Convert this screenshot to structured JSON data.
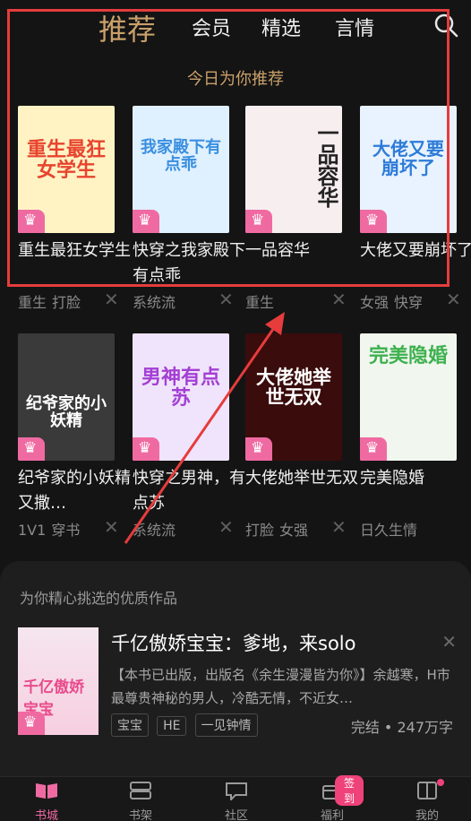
{
  "header": {
    "tabs": [
      "推荐",
      "会员",
      "精选",
      "言情"
    ]
  },
  "section_title": "今日为你推荐",
  "books": [
    {
      "title": "重生最狂女学生",
      "tags": [
        "重生",
        "打脸"
      ],
      "cover_text": "重生最狂女学生",
      "cover_bg": "#fff3c4",
      "cover_fg": "#e8442e"
    },
    {
      "title": "快穿之我家殿下有点乖",
      "tags": [
        "系统流"
      ],
      "cover_text": "我家殿下有点乖",
      "cover_bg": "#dff0ff",
      "cover_fg": "#3a8fe0"
    },
    {
      "title": "一品容华",
      "tags": [
        "重生"
      ],
      "cover_text": "一品容华",
      "cover_bg": "#f7eef0",
      "cover_fg": "#222222"
    },
    {
      "title": "大佬又要崩坏了",
      "tags": [
        "女强",
        "快穿"
      ],
      "cover_text": "大佬又要崩坏了",
      "cover_bg": "#e8f3ff",
      "cover_fg": "#2d7bd8"
    },
    {
      "title": "纪爷家的小妖精又撒…",
      "tags": [
        "1V1",
        "穿书"
      ],
      "cover_text": "纪爷家的小妖精",
      "cover_bg": "#3a3a3a",
      "cover_fg": "#ffffff"
    },
    {
      "title": "快穿之男神，有点苏",
      "tags": [
        "系统流"
      ],
      "cover_text": "男神有点苏",
      "cover_bg": "#efe4fb",
      "cover_fg": "#a43fd4"
    },
    {
      "title": "大佬她举世无双",
      "tags": [
        "打脸",
        "女强"
      ],
      "cover_text": "大佬她举世无双",
      "cover_bg": "#3a0c0c",
      "cover_fg": "#ffffff"
    },
    {
      "title": "完美隐婚",
      "tags": [
        "日久生情"
      ],
      "cover_text": "完美隐婚",
      "cover_bg": "#f1f6ee",
      "cover_fg": "#3db14f"
    }
  ],
  "card": {
    "title": "为你精心挑选的优质作品",
    "book_title": "千亿傲娇宝宝：爹地，来solo",
    "cover_text": "千亿傲娇宝宝",
    "description": "【本书已出版，出版名《余生漫漫皆为你》】余越寒，H市最尊贵神秘的男人，冷酷无情，不近女…",
    "tags": [
      "宝宝",
      "HE",
      "一见钟情"
    ],
    "status": "完结 • 247万字"
  },
  "nav": {
    "items": [
      "书城",
      "书架",
      "社区",
      "福利",
      "我的"
    ],
    "badge": "签到"
  }
}
